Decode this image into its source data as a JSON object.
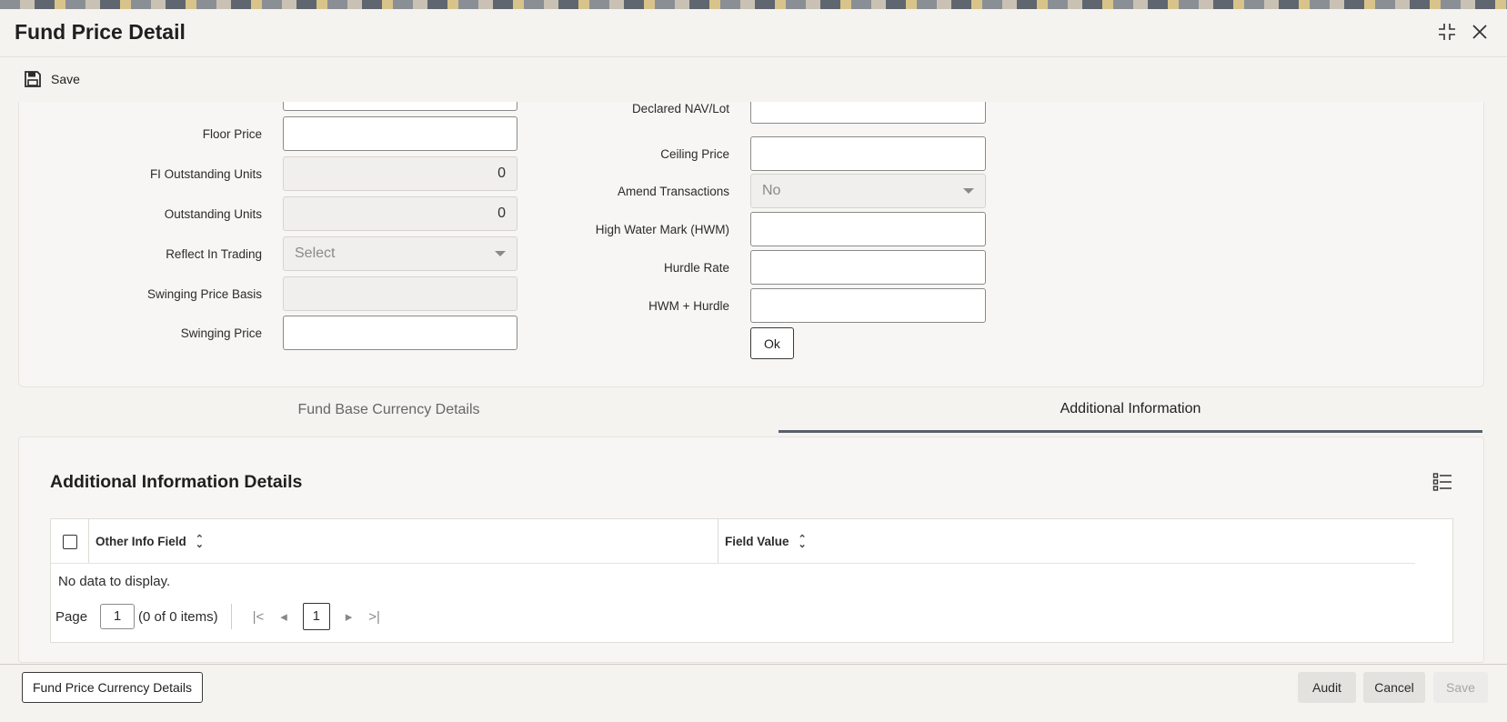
{
  "window": {
    "title": "Fund Price Detail",
    "restore_icon": "collapse-icon",
    "close_icon": "close-icon"
  },
  "toolbar": {
    "save_label": "Save"
  },
  "form": {
    "left": {
      "floor_price": {
        "label": "Floor Price",
        "value": ""
      },
      "fi_outstanding_units": {
        "label": "FI Outstanding Units",
        "value": "0"
      },
      "outstanding_units": {
        "label": "Outstanding Units",
        "value": "0"
      },
      "reflect_in_trading": {
        "label": "Reflect In Trading",
        "placeholder": "Select"
      },
      "swinging_price_basis": {
        "label": "Swinging Price Basis",
        "value": ""
      },
      "swinging_price": {
        "label": "Swinging Price",
        "value": ""
      }
    },
    "right": {
      "declared_nav_lot": {
        "label": "Declared NAV/Lot",
        "value": ""
      },
      "ceiling_price": {
        "label": "Ceiling Price",
        "value": ""
      },
      "amend_transactions": {
        "label": "Amend Transactions",
        "value": "No"
      },
      "high_water_mark": {
        "label": "High Water Mark (HWM)",
        "value": ""
      },
      "hurdle_rate": {
        "label": "Hurdle Rate",
        "value": ""
      },
      "hwm_hurdle": {
        "label": "HWM + Hurdle",
        "value": ""
      },
      "ok_label": "Ok"
    }
  },
  "tabs": [
    {
      "label": "Fund Base Currency Details",
      "active": false
    },
    {
      "label": "Additional Information",
      "active": true
    }
  ],
  "additional_info": {
    "title": "Additional Information Details",
    "columns": [
      "Other Info Field",
      "Field Value"
    ],
    "rows": [],
    "empty_text": "No data to display.",
    "pager": {
      "page_label": "Page",
      "page_value": "1",
      "items_text": "(0 of 0 items)",
      "current_page": "1"
    }
  },
  "footer": {
    "fund_price_currency_details": "Fund Price Currency Details",
    "audit": "Audit",
    "cancel": "Cancel",
    "save": "Save"
  }
}
